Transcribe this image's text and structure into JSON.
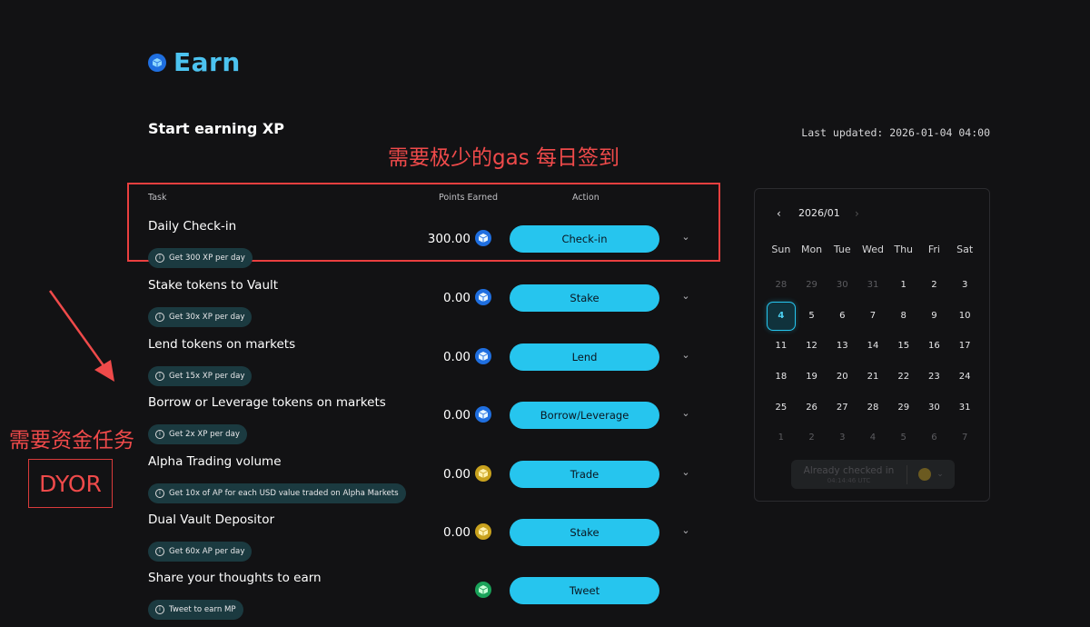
{
  "header": {
    "logo_text": "Earn",
    "section_title": "Start earning XP",
    "last_updated": "Last updated: 2026-01-04 04:00"
  },
  "annotations": {
    "top_note": "需要极少的gas 每日签到",
    "left_note": "需要资金任务",
    "dyor": "DYOR"
  },
  "table": {
    "headers": {
      "task": "Task",
      "points": "Points Earned",
      "action": "Action"
    },
    "rows": [
      {
        "name": "Daily Check-in",
        "pill": "Get 300 XP per day",
        "points": "300.00",
        "icon": "blue-cube-icon",
        "action": "Check-in"
      },
      {
        "name": "Stake tokens to Vault",
        "pill": "Get 30x XP per day",
        "points": "0.00",
        "icon": "blue-cube-icon",
        "action": "Stake"
      },
      {
        "name": "Lend tokens on markets",
        "pill": "Get 15x XP per day",
        "points": "0.00",
        "icon": "blue-cube-icon",
        "action": "Lend"
      },
      {
        "name": "Borrow or Leverage tokens on markets",
        "pill": "Get 2x XP per day",
        "points": "0.00",
        "icon": "blue-cube-icon",
        "action": "Borrow/Leverage"
      },
      {
        "name": "Alpha Trading volume",
        "pill": "Get 10x of AP for each USD value traded on Alpha Markets",
        "points": "0.00",
        "icon": "gold-cube-icon",
        "action": "Trade"
      },
      {
        "name": "Dual Vault Depositor",
        "pill": "Get 60x AP per day",
        "points": "0.00",
        "icon": "gold-cube-icon",
        "action": "Stake"
      },
      {
        "name": "Share your thoughts to earn",
        "pill": "Tweet to earn MP",
        "points": "",
        "icon": "green-cube-icon",
        "action": "Tweet"
      }
    ]
  },
  "calendar": {
    "month": "2026/01",
    "weekdays": [
      "Sun",
      "Mon",
      "Tue",
      "Wed",
      "Thu",
      "Fri",
      "Sat"
    ],
    "days": [
      {
        "d": "28",
        "m": "prev"
      },
      {
        "d": "29",
        "m": "prev"
      },
      {
        "d": "30",
        "m": "prev"
      },
      {
        "d": "31",
        "m": "prev"
      },
      {
        "d": "1",
        "m": "cur"
      },
      {
        "d": "2",
        "m": "cur"
      },
      {
        "d": "3",
        "m": "cur"
      },
      {
        "d": "4",
        "m": "today"
      },
      {
        "d": "5",
        "m": "cur"
      },
      {
        "d": "6",
        "m": "cur"
      },
      {
        "d": "7",
        "m": "cur"
      },
      {
        "d": "8",
        "m": "cur"
      },
      {
        "d": "9",
        "m": "cur"
      },
      {
        "d": "10",
        "m": "cur"
      },
      {
        "d": "11",
        "m": "cur"
      },
      {
        "d": "12",
        "m": "cur"
      },
      {
        "d": "13",
        "m": "cur"
      },
      {
        "d": "14",
        "m": "cur"
      },
      {
        "d": "15",
        "m": "cur"
      },
      {
        "d": "16",
        "m": "cur"
      },
      {
        "d": "17",
        "m": "cur"
      },
      {
        "d": "18",
        "m": "cur"
      },
      {
        "d": "19",
        "m": "cur"
      },
      {
        "d": "20",
        "m": "cur"
      },
      {
        "d": "21",
        "m": "cur"
      },
      {
        "d": "22",
        "m": "cur"
      },
      {
        "d": "23",
        "m": "cur"
      },
      {
        "d": "24",
        "m": "cur"
      },
      {
        "d": "25",
        "m": "cur"
      },
      {
        "d": "26",
        "m": "cur"
      },
      {
        "d": "27",
        "m": "cur"
      },
      {
        "d": "28",
        "m": "cur"
      },
      {
        "d": "29",
        "m": "cur"
      },
      {
        "d": "30",
        "m": "cur"
      },
      {
        "d": "31",
        "m": "cur"
      },
      {
        "d": "1",
        "m": "next"
      },
      {
        "d": "2",
        "m": "next"
      },
      {
        "d": "3",
        "m": "next"
      },
      {
        "d": "4",
        "m": "next"
      },
      {
        "d": "5",
        "m": "next"
      },
      {
        "d": "6",
        "m": "next"
      },
      {
        "d": "7",
        "m": "next"
      }
    ],
    "checked_label": "Already checked in",
    "checked_time": "04:14:46 UTC"
  },
  "colors": {
    "accent": "#26c5ee",
    "background": "#121214",
    "annotation": "#ef4a4a"
  }
}
